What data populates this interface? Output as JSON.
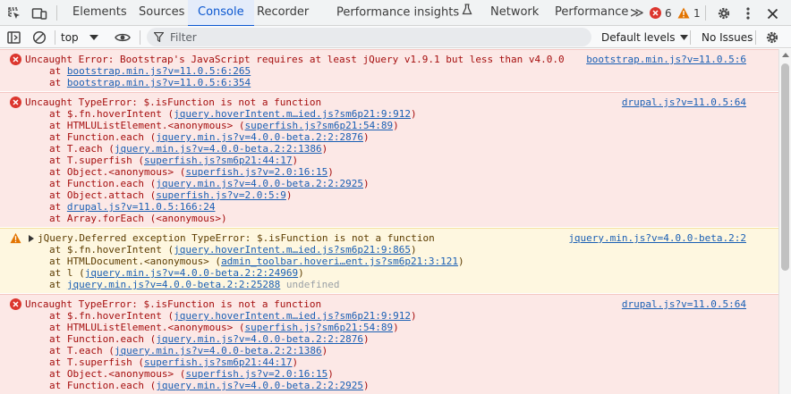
{
  "tabs": {
    "items": [
      "Elements",
      "Sources",
      "Console",
      "Recorder",
      "Performance insights",
      "Network",
      "Performance"
    ],
    "active": "Console",
    "more_symbol": "≫",
    "error_count": "6",
    "warning_count": "1"
  },
  "toolbar": {
    "context": "top",
    "filter_placeholder": "Filter",
    "levels": "Default levels",
    "issues": "No Issues"
  },
  "colors": {
    "error_bg": "#fce8e6",
    "error_text": "#a50e0e",
    "warning_bg": "#fef7e0",
    "link": "#1a5fb4",
    "accent": "#0b57d0"
  },
  "messages": [
    {
      "level": "error",
      "text": "Uncaught Error: Bootstrap's JavaScript requires at least jQuery v1.9.1 but less than v4.0.0",
      "source": "bootstrap.min.js?v=11.0.5:6",
      "frames": [
        {
          "prefix": "at ",
          "link": "bootstrap.min.js?v=11.0.5:6:265"
        },
        {
          "prefix": "at ",
          "link": "bootstrap.min.js?v=11.0.5:6:354"
        }
      ]
    },
    {
      "level": "error",
      "text": "Uncaught TypeError: $.isFunction is not a function",
      "source": "drupal.js?v=11.0.5:64",
      "frames": [
        {
          "prefix": "at $.fn.hoverIntent (",
          "link": "jquery.hoverIntent.m…ied.js?sm6p21:9:912",
          "suffix": ")"
        },
        {
          "prefix": "at HTMLUListElement.<anonymous> (",
          "link": "superfish.js?sm6p21:54:89",
          "suffix": ")"
        },
        {
          "prefix": "at Function.each (",
          "link": "jquery.min.js?v=4.0.0-beta.2:2:2876",
          "suffix": ")"
        },
        {
          "prefix": "at T.each (",
          "link": "jquery.min.js?v=4.0.0-beta.2:2:1386",
          "suffix": ")"
        },
        {
          "prefix": "at T.superfish (",
          "link": "superfish.js?sm6p21:44:17",
          "suffix": ")"
        },
        {
          "prefix": "at Object.<anonymous> (",
          "link": "superfish.js?v=2.0:16:15",
          "suffix": ")"
        },
        {
          "prefix": "at Function.each (",
          "link": "jquery.min.js?v=4.0.0-beta.2:2:2925",
          "suffix": ")"
        },
        {
          "prefix": "at Object.attach (",
          "link": "superfish.js?v=2.0:5:9",
          "suffix": ")"
        },
        {
          "prefix": "at ",
          "link": "drupal.js?v=11.0.5:166:24"
        },
        {
          "prefix": "at Array.forEach (<anonymous>)"
        }
      ]
    },
    {
      "level": "warning",
      "text": "jQuery.Deferred exception TypeError: $.isFunction is not a function",
      "source": "jquery.min.js?v=4.0.0-beta.2:2",
      "frames": [
        {
          "prefix": "at $.fn.hoverIntent (",
          "link": "jquery.hoverIntent.m…ied.js?sm6p21:9:865",
          "suffix": ")"
        },
        {
          "prefix": "at HTMLDocument.<anonymous> (",
          "link": "admin_toolbar.hoveri…ent.js?sm6p21:3:121",
          "suffix": ")"
        },
        {
          "prefix": "at l (",
          "link": "jquery.min.js?v=4.0.0-beta.2:2:24969",
          "suffix": ")"
        },
        {
          "prefix": "at ",
          "link": "jquery.min.js?v=4.0.0-beta.2:2:25288",
          "muted": " undefined"
        }
      ]
    },
    {
      "level": "error",
      "text": "Uncaught TypeError: $.isFunction is not a function",
      "source": "drupal.js?v=11.0.5:64",
      "frames": [
        {
          "prefix": "at $.fn.hoverIntent (",
          "link": "jquery.hoverIntent.m…ied.js?sm6p21:9:912",
          "suffix": ")"
        },
        {
          "prefix": "at HTMLUListElement.<anonymous> (",
          "link": "superfish.js?sm6p21:54:89",
          "suffix": ")"
        },
        {
          "prefix": "at Function.each (",
          "link": "jquery.min.js?v=4.0.0-beta.2:2:2876",
          "suffix": ")"
        },
        {
          "prefix": "at T.each (",
          "link": "jquery.min.js?v=4.0.0-beta.2:2:1386",
          "suffix": ")"
        },
        {
          "prefix": "at T.superfish (",
          "link": "superfish.js?sm6p21:44:17",
          "suffix": ")"
        },
        {
          "prefix": "at Object.<anonymous> (",
          "link": "superfish.js?v=2.0:16:15",
          "suffix": ")"
        },
        {
          "prefix": "at Function.each (",
          "link": "jquery.min.js?v=4.0.0-beta.2:2:2925",
          "suffix": ")"
        }
      ]
    }
  ]
}
